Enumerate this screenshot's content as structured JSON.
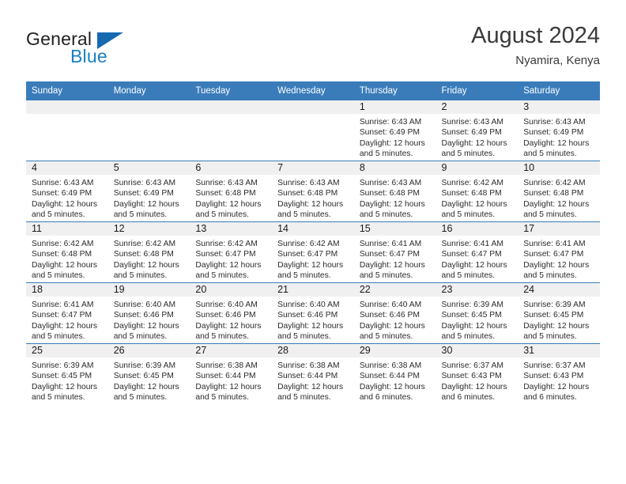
{
  "brand": {
    "line1": "General",
    "line2": "Blue",
    "mark_icon": "triangle-logo-icon",
    "accent_color": "#1569b0"
  },
  "header": {
    "title": "August 2024",
    "subtitle": "Nyamira, Kenya"
  },
  "calendar": {
    "header_color": "#3a7cba",
    "weekday_headers": [
      "Sunday",
      "Monday",
      "Tuesday",
      "Wednesday",
      "Thursday",
      "Friday",
      "Saturday"
    ],
    "weeks": [
      [
        {
          "day": "",
          "sunrise": "",
          "sunset": "",
          "daylight1": "",
          "daylight2": ""
        },
        {
          "day": "",
          "sunrise": "",
          "sunset": "",
          "daylight1": "",
          "daylight2": ""
        },
        {
          "day": "",
          "sunrise": "",
          "sunset": "",
          "daylight1": "",
          "daylight2": ""
        },
        {
          "day": "",
          "sunrise": "",
          "sunset": "",
          "daylight1": "",
          "daylight2": ""
        },
        {
          "day": "1",
          "sunrise": "Sunrise: 6:43 AM",
          "sunset": "Sunset: 6:49 PM",
          "daylight1": "Daylight: 12 hours",
          "daylight2": "and 5 minutes."
        },
        {
          "day": "2",
          "sunrise": "Sunrise: 6:43 AM",
          "sunset": "Sunset: 6:49 PM",
          "daylight1": "Daylight: 12 hours",
          "daylight2": "and 5 minutes."
        },
        {
          "day": "3",
          "sunrise": "Sunrise: 6:43 AM",
          "sunset": "Sunset: 6:49 PM",
          "daylight1": "Daylight: 12 hours",
          "daylight2": "and 5 minutes."
        }
      ],
      [
        {
          "day": "4",
          "sunrise": "Sunrise: 6:43 AM",
          "sunset": "Sunset: 6:49 PM",
          "daylight1": "Daylight: 12 hours",
          "daylight2": "and 5 minutes."
        },
        {
          "day": "5",
          "sunrise": "Sunrise: 6:43 AM",
          "sunset": "Sunset: 6:49 PM",
          "daylight1": "Daylight: 12 hours",
          "daylight2": "and 5 minutes."
        },
        {
          "day": "6",
          "sunrise": "Sunrise: 6:43 AM",
          "sunset": "Sunset: 6:48 PM",
          "daylight1": "Daylight: 12 hours",
          "daylight2": "and 5 minutes."
        },
        {
          "day": "7",
          "sunrise": "Sunrise: 6:43 AM",
          "sunset": "Sunset: 6:48 PM",
          "daylight1": "Daylight: 12 hours",
          "daylight2": "and 5 minutes."
        },
        {
          "day": "8",
          "sunrise": "Sunrise: 6:43 AM",
          "sunset": "Sunset: 6:48 PM",
          "daylight1": "Daylight: 12 hours",
          "daylight2": "and 5 minutes."
        },
        {
          "day": "9",
          "sunrise": "Sunrise: 6:42 AM",
          "sunset": "Sunset: 6:48 PM",
          "daylight1": "Daylight: 12 hours",
          "daylight2": "and 5 minutes."
        },
        {
          "day": "10",
          "sunrise": "Sunrise: 6:42 AM",
          "sunset": "Sunset: 6:48 PM",
          "daylight1": "Daylight: 12 hours",
          "daylight2": "and 5 minutes."
        }
      ],
      [
        {
          "day": "11",
          "sunrise": "Sunrise: 6:42 AM",
          "sunset": "Sunset: 6:48 PM",
          "daylight1": "Daylight: 12 hours",
          "daylight2": "and 5 minutes."
        },
        {
          "day": "12",
          "sunrise": "Sunrise: 6:42 AM",
          "sunset": "Sunset: 6:48 PM",
          "daylight1": "Daylight: 12 hours",
          "daylight2": "and 5 minutes."
        },
        {
          "day": "13",
          "sunrise": "Sunrise: 6:42 AM",
          "sunset": "Sunset: 6:47 PM",
          "daylight1": "Daylight: 12 hours",
          "daylight2": "and 5 minutes."
        },
        {
          "day": "14",
          "sunrise": "Sunrise: 6:42 AM",
          "sunset": "Sunset: 6:47 PM",
          "daylight1": "Daylight: 12 hours",
          "daylight2": "and 5 minutes."
        },
        {
          "day": "15",
          "sunrise": "Sunrise: 6:41 AM",
          "sunset": "Sunset: 6:47 PM",
          "daylight1": "Daylight: 12 hours",
          "daylight2": "and 5 minutes."
        },
        {
          "day": "16",
          "sunrise": "Sunrise: 6:41 AM",
          "sunset": "Sunset: 6:47 PM",
          "daylight1": "Daylight: 12 hours",
          "daylight2": "and 5 minutes."
        },
        {
          "day": "17",
          "sunrise": "Sunrise: 6:41 AM",
          "sunset": "Sunset: 6:47 PM",
          "daylight1": "Daylight: 12 hours",
          "daylight2": "and 5 minutes."
        }
      ],
      [
        {
          "day": "18",
          "sunrise": "Sunrise: 6:41 AM",
          "sunset": "Sunset: 6:47 PM",
          "daylight1": "Daylight: 12 hours",
          "daylight2": "and 5 minutes."
        },
        {
          "day": "19",
          "sunrise": "Sunrise: 6:40 AM",
          "sunset": "Sunset: 6:46 PM",
          "daylight1": "Daylight: 12 hours",
          "daylight2": "and 5 minutes."
        },
        {
          "day": "20",
          "sunrise": "Sunrise: 6:40 AM",
          "sunset": "Sunset: 6:46 PM",
          "daylight1": "Daylight: 12 hours",
          "daylight2": "and 5 minutes."
        },
        {
          "day": "21",
          "sunrise": "Sunrise: 6:40 AM",
          "sunset": "Sunset: 6:46 PM",
          "daylight1": "Daylight: 12 hours",
          "daylight2": "and 5 minutes."
        },
        {
          "day": "22",
          "sunrise": "Sunrise: 6:40 AM",
          "sunset": "Sunset: 6:46 PM",
          "daylight1": "Daylight: 12 hours",
          "daylight2": "and 5 minutes."
        },
        {
          "day": "23",
          "sunrise": "Sunrise: 6:39 AM",
          "sunset": "Sunset: 6:45 PM",
          "daylight1": "Daylight: 12 hours",
          "daylight2": "and 5 minutes."
        },
        {
          "day": "24",
          "sunrise": "Sunrise: 6:39 AM",
          "sunset": "Sunset: 6:45 PM",
          "daylight1": "Daylight: 12 hours",
          "daylight2": "and 5 minutes."
        }
      ],
      [
        {
          "day": "25",
          "sunrise": "Sunrise: 6:39 AM",
          "sunset": "Sunset: 6:45 PM",
          "daylight1": "Daylight: 12 hours",
          "daylight2": "and 5 minutes."
        },
        {
          "day": "26",
          "sunrise": "Sunrise: 6:39 AM",
          "sunset": "Sunset: 6:45 PM",
          "daylight1": "Daylight: 12 hours",
          "daylight2": "and 5 minutes."
        },
        {
          "day": "27",
          "sunrise": "Sunrise: 6:38 AM",
          "sunset": "Sunset: 6:44 PM",
          "daylight1": "Daylight: 12 hours",
          "daylight2": "and 5 minutes."
        },
        {
          "day": "28",
          "sunrise": "Sunrise: 6:38 AM",
          "sunset": "Sunset: 6:44 PM",
          "daylight1": "Daylight: 12 hours",
          "daylight2": "and 5 minutes."
        },
        {
          "day": "29",
          "sunrise": "Sunrise: 6:38 AM",
          "sunset": "Sunset: 6:44 PM",
          "daylight1": "Daylight: 12 hours",
          "daylight2": "and 6 minutes."
        },
        {
          "day": "30",
          "sunrise": "Sunrise: 6:37 AM",
          "sunset": "Sunset: 6:43 PM",
          "daylight1": "Daylight: 12 hours",
          "daylight2": "and 6 minutes."
        },
        {
          "day": "31",
          "sunrise": "Sunrise: 6:37 AM",
          "sunset": "Sunset: 6:43 PM",
          "daylight1": "Daylight: 12 hours",
          "daylight2": "and 6 minutes."
        }
      ]
    ]
  }
}
